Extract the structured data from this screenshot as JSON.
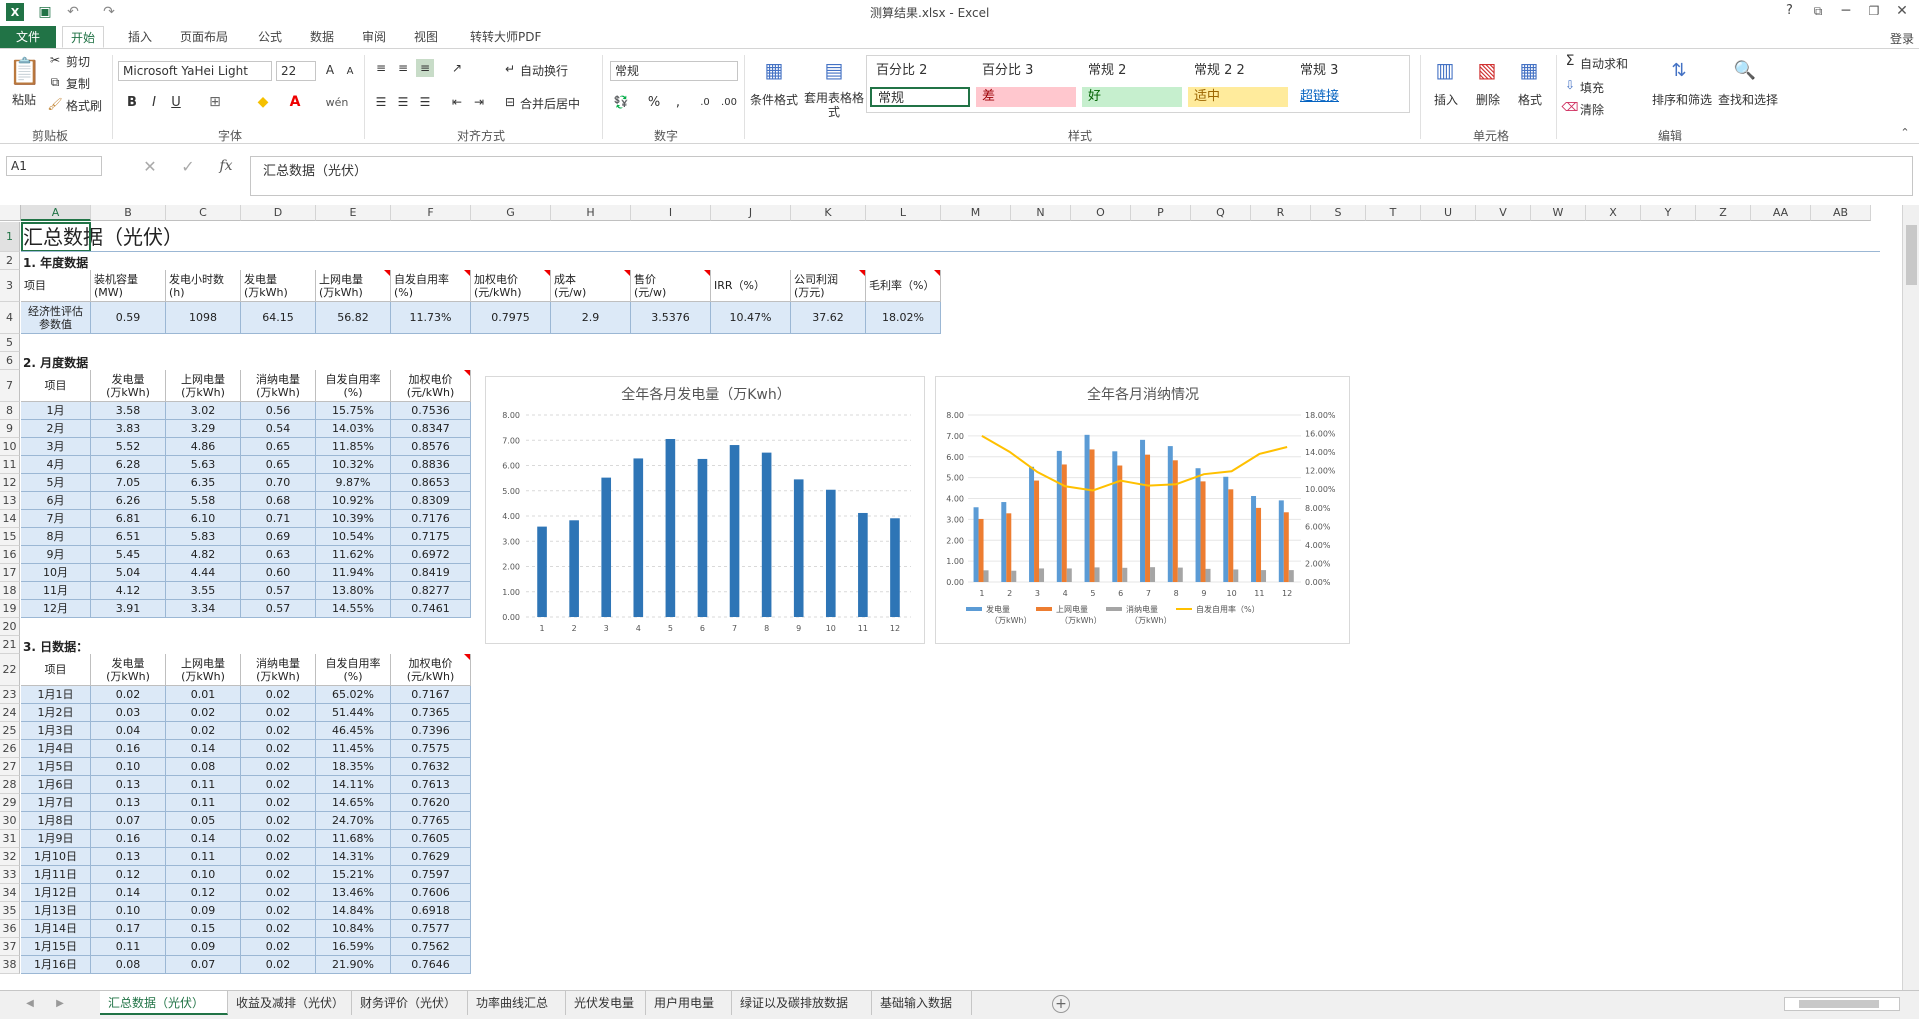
{
  "window": {
    "title": "测算结果.xlsx - Excel",
    "login": "登录",
    "help": "?"
  },
  "ribbon_tabs": [
    "文件",
    "开始",
    "插入",
    "页面布局",
    "公式",
    "数据",
    "审阅",
    "视图",
    "转转大师PDF"
  ],
  "ribbon": {
    "clipboard": {
      "paste": "粘贴",
      "cut": "剪切",
      "copy": "复制",
      "format_painter": "格式刷",
      "group": "剪贴板"
    },
    "font": {
      "name": "Microsoft YaHei Light",
      "size": "22",
      "bold": "B",
      "italic": "I",
      "underline": "U",
      "group": "字体"
    },
    "alignment": {
      "wrap": "自动换行",
      "merge": "合并后居中",
      "group": "对齐方式"
    },
    "number": {
      "format": "常规",
      "percent": "%",
      "comma": ",",
      "group": "数字"
    },
    "styles": {
      "cond_format": "条件格式",
      "table_format": "套用表格格式",
      "cells": [
        {
          "label": "百分比 2",
          "bg": "#ffffff",
          "color": "#333333"
        },
        {
          "label": "百分比 3",
          "bg": "#ffffff",
          "color": "#333333"
        },
        {
          "label": "常规 2",
          "bg": "#ffffff",
          "color": "#333333"
        },
        {
          "label": "常规 2 2",
          "bg": "#ffffff",
          "color": "#333333"
        },
        {
          "label": "常规 3",
          "bg": "#ffffff",
          "color": "#333333"
        },
        {
          "label": "常规",
          "bg": "#ffffff",
          "color": "#333333"
        },
        {
          "label": "差",
          "bg": "#ffc7ce",
          "color": "#9c0006"
        },
        {
          "label": "好",
          "bg": "#c6efce",
          "color": "#006100"
        },
        {
          "label": "适中",
          "bg": "#ffeb9c",
          "color": "#9c6500"
        },
        {
          "label": "超链接",
          "bg": "#ffffff",
          "color": "#0563c1"
        }
      ],
      "group": "样式"
    },
    "cells": {
      "insert": "插入",
      "delete": "删除",
      "format": "格式",
      "group": "单元格"
    },
    "editing": {
      "autosum": "自动求和",
      "fill": "填充",
      "clear": "清除",
      "sort": "排序和筛选",
      "find": "查找和选择",
      "group": "编辑"
    }
  },
  "formula_bar": {
    "name_box": "A1",
    "fx": "fx",
    "content": "汇总数据（光伏）"
  },
  "columns": [
    "A",
    "B",
    "C",
    "D",
    "E",
    "F",
    "G",
    "H",
    "I",
    "J",
    "K",
    "L",
    "M",
    "N",
    "O",
    "P",
    "Q",
    "R",
    "S",
    "T",
    "U",
    "V",
    "W",
    "X",
    "Y",
    "Z",
    "AA",
    "AB"
  ],
  "rows": [
    "1",
    "2",
    "3",
    "4",
    "5",
    "6",
    "7",
    "8",
    "9",
    "10",
    "11",
    "12",
    "13",
    "14",
    "15",
    "16",
    "17",
    "18",
    "19",
    "20",
    "21",
    "22",
    "23",
    "24",
    "25",
    "26",
    "27",
    "28",
    "29",
    "30",
    "31",
    "32",
    "33",
    "34",
    "35",
    "36",
    "37",
    "38"
  ],
  "sheet": {
    "title": "汇总数据（光伏）",
    "sec1": "1. 年度数据",
    "annual_headers": [
      "项目",
      "装机容量\n(MW)",
      "发电小时数\n(h)",
      "发电量\n(万kWh)",
      "上网电量\n(万kWh)",
      "自发自用率\n(%)",
      "加权电价\n(元/kWh)",
      "成本\n(元/w)",
      "售价\n(元/w)",
      "IRR（%）",
      "公司利润\n(万元)",
      "毛利率（%）"
    ],
    "annual_values": [
      "经济性评估\n参数值",
      "0.59",
      "1098",
      "64.15",
      "56.82",
      "11.73%",
      "0.7975",
      "2.9",
      "3.5376",
      "10.47%",
      "37.62",
      "18.02%"
    ],
    "sec2": "2. 月度数据",
    "month_headers": [
      "项目",
      "发电量\n(万kWh)",
      "上网电量\n(万kWh)",
      "消纳电量\n(万kWh)",
      "自发自用率\n(%)",
      "加权电价\n(元/kWh)"
    ],
    "month_rows": [
      [
        "1月",
        "3.58",
        "3.02",
        "0.56",
        "15.75%",
        "0.7536"
      ],
      [
        "2月",
        "3.83",
        "3.29",
        "0.54",
        "14.03%",
        "0.8347"
      ],
      [
        "3月",
        "5.52",
        "4.86",
        "0.65",
        "11.85%",
        "0.8576"
      ],
      [
        "4月",
        "6.28",
        "5.63",
        "0.65",
        "10.32%",
        "0.8836"
      ],
      [
        "5月",
        "7.05",
        "6.35",
        "0.70",
        "9.87%",
        "0.8653"
      ],
      [
        "6月",
        "6.26",
        "5.58",
        "0.68",
        "10.92%",
        "0.8309"
      ],
      [
        "7月",
        "6.81",
        "6.10",
        "0.71",
        "10.39%",
        "0.7176"
      ],
      [
        "8月",
        "6.51",
        "5.83",
        "0.69",
        "10.54%",
        "0.7175"
      ],
      [
        "9月",
        "5.45",
        "4.82",
        "0.63",
        "11.62%",
        "0.6972"
      ],
      [
        "10月",
        "5.04",
        "4.44",
        "0.60",
        "11.94%",
        "0.8419"
      ],
      [
        "11月",
        "4.12",
        "3.55",
        "0.57",
        "13.80%",
        "0.8277"
      ],
      [
        "12月",
        "3.91",
        "3.34",
        "0.57",
        "14.55%",
        "0.7461"
      ]
    ],
    "sec3": "3. 日数据：",
    "day_headers": [
      "项目",
      "发电量\n(万kWh)",
      "上网电量\n(万kWh)",
      "消纳电量\n(万kWh)",
      "自发自用率\n(%)",
      "加权电价\n(元/kWh)"
    ],
    "day_rows": [
      [
        "1月1日",
        "0.02",
        "0.01",
        "0.02",
        "65.02%",
        "0.7167"
      ],
      [
        "1月2日",
        "0.03",
        "0.02",
        "0.02",
        "51.44%",
        "0.7365"
      ],
      [
        "1月3日",
        "0.04",
        "0.02",
        "0.02",
        "46.45%",
        "0.7396"
      ],
      [
        "1月4日",
        "0.16",
        "0.14",
        "0.02",
        "11.45%",
        "0.7575"
      ],
      [
        "1月5日",
        "0.10",
        "0.08",
        "0.02",
        "18.35%",
        "0.7632"
      ],
      [
        "1月6日",
        "0.13",
        "0.11",
        "0.02",
        "14.11%",
        "0.7613"
      ],
      [
        "1月7日",
        "0.13",
        "0.11",
        "0.02",
        "14.65%",
        "0.7620"
      ],
      [
        "1月8日",
        "0.07",
        "0.05",
        "0.02",
        "24.70%",
        "0.7765"
      ],
      [
        "1月9日",
        "0.16",
        "0.14",
        "0.02",
        "11.68%",
        "0.7605"
      ],
      [
        "1月10日",
        "0.13",
        "0.11",
        "0.02",
        "14.31%",
        "0.7629"
      ],
      [
        "1月11日",
        "0.12",
        "0.10",
        "0.02",
        "15.21%",
        "0.7597"
      ],
      [
        "1月12日",
        "0.14",
        "0.12",
        "0.02",
        "13.46%",
        "0.7606"
      ],
      [
        "1月13日",
        "0.10",
        "0.09",
        "0.02",
        "14.84%",
        "0.6918"
      ],
      [
        "1月14日",
        "0.17",
        "0.15",
        "0.02",
        "10.84%",
        "0.7577"
      ],
      [
        "1月15日",
        "0.11",
        "0.09",
        "0.02",
        "16.59%",
        "0.7562"
      ],
      [
        "1月16日",
        "0.08",
        "0.07",
        "0.02",
        "21.90%",
        "0.7646"
      ]
    ]
  },
  "chart_data": [
    {
      "type": "bar",
      "title": "全年各月发电量（万Kwh）",
      "categories": [
        "1",
        "2",
        "3",
        "4",
        "5",
        "6",
        "7",
        "8",
        "9",
        "10",
        "11",
        "12"
      ],
      "values": [
        3.58,
        3.83,
        5.52,
        6.28,
        7.05,
        6.26,
        6.81,
        6.51,
        5.45,
        5.04,
        4.12,
        3.91
      ],
      "ylim": [
        0,
        8
      ],
      "yticks": [
        "0.00",
        "1.00",
        "2.00",
        "3.00",
        "4.00",
        "5.00",
        "6.00",
        "7.00",
        "8.00"
      ],
      "grid": true,
      "color": "#2e75b6"
    },
    {
      "type": "bar",
      "title": "全年各月消纳情况",
      "categories": [
        "1",
        "2",
        "3",
        "4",
        "5",
        "6",
        "7",
        "8",
        "9",
        "10",
        "11",
        "12"
      ],
      "series": [
        {
          "name": "发电量\n（万kWh）",
          "values": [
            3.58,
            3.83,
            5.52,
            6.28,
            7.05,
            6.26,
            6.81,
            6.51,
            5.45,
            5.04,
            4.12,
            3.91
          ],
          "color": "#5b9bd5",
          "kind": "bar"
        },
        {
          "name": "上网电量\n（万kWh）",
          "values": [
            3.02,
            3.29,
            4.86,
            5.63,
            6.35,
            5.58,
            6.1,
            5.83,
            4.82,
            4.44,
            3.55,
            3.34
          ],
          "color": "#ed7d31",
          "kind": "bar"
        },
        {
          "name": "消纳电量\n（万kWh）",
          "values": [
            0.56,
            0.54,
            0.65,
            0.65,
            0.7,
            0.68,
            0.71,
            0.69,
            0.63,
            0.6,
            0.57,
            0.57
          ],
          "color": "#a5a5a5",
          "kind": "bar"
        },
        {
          "name": "自发自用率（%）",
          "values": [
            15.75,
            14.03,
            11.85,
            10.32,
            9.87,
            10.92,
            10.39,
            10.54,
            11.62,
            11.94,
            13.8,
            14.55
          ],
          "color": "#ffc000",
          "kind": "line",
          "axis": "right"
        }
      ],
      "ylim": [
        0,
        8
      ],
      "yticks": [
        "0.00",
        "1.00",
        "2.00",
        "3.00",
        "4.00",
        "5.00",
        "6.00",
        "7.00",
        "8.00"
      ],
      "y2lim": [
        0,
        18
      ],
      "y2ticks": [
        "0.00%",
        "2.00%",
        "4.00%",
        "6.00%",
        "8.00%",
        "10.00%",
        "12.00%",
        "14.00%",
        "16.00%",
        "18.00%"
      ],
      "legend": "bottom"
    }
  ],
  "sheet_tabs": [
    "汇总数据（光伏）",
    "收益及减排（光伏）",
    "财务评价（光伏）",
    "功率曲线汇总",
    "光伏发电量",
    "用户用电量",
    "绿证以及碳排放数据",
    "基础输入数据"
  ],
  "colors": {
    "accent": "#217346",
    "cell_blue": "#dce9f7",
    "border": "#9bb7d4"
  }
}
